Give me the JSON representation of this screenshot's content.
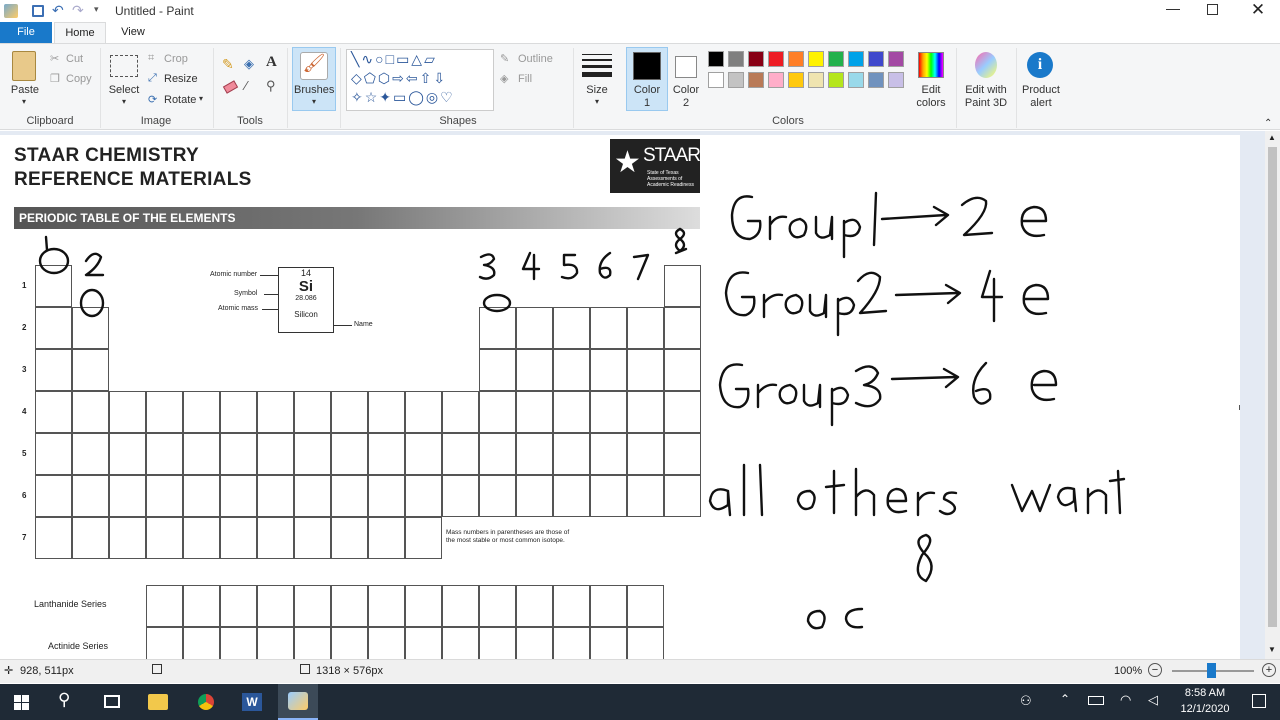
{
  "titlebar": {
    "title": "Untitled - Paint"
  },
  "tabs": [
    {
      "label": "File"
    },
    {
      "label": "Home"
    },
    {
      "label": "View"
    }
  ],
  "ribbon": {
    "clipboard": {
      "paste": "Paste",
      "cut": "Cut",
      "copy": "Copy",
      "group": "Clipboard"
    },
    "image": {
      "select": "Select",
      "crop": "Crop",
      "resize": "Resize",
      "rotate": "Rotate",
      "group": "Image"
    },
    "tools": {
      "group": "Tools"
    },
    "brushes": {
      "label": "Brushes"
    },
    "shapes": {
      "outline": "Outline",
      "fill": "Fill",
      "group": "Shapes"
    },
    "size": {
      "label": "Size"
    },
    "color1": {
      "label": "Color",
      "sub": "1"
    },
    "color2": {
      "label": "Color",
      "sub": "2"
    },
    "colors_group": "Colors",
    "edit_colors": {
      "line1": "Edit",
      "line2": "colors"
    },
    "paint3d": {
      "line1": "Edit with",
      "line2": "Paint 3D"
    },
    "product_alert": {
      "line1": "Product",
      "line2": "alert"
    },
    "palette_row1": [
      "#000000",
      "#7f7f7f",
      "#880015",
      "#ed1c24",
      "#ff7f27",
      "#fff200",
      "#22b14c",
      "#00a2e8",
      "#3f48cc",
      "#a349a4"
    ],
    "palette_row2": [
      "#ffffff",
      "#c3c3c3",
      "#b97a57",
      "#ffaec9",
      "#ffc90e",
      "#efe4b0",
      "#b5e61d",
      "#99d9ea",
      "#7092be",
      "#c8bfe7"
    ]
  },
  "doc": {
    "title1": "STAAR CHEMISTRY",
    "title2": "REFERENCE MATERIALS",
    "logo": "STAAR",
    "logo_sub1": "State of Texas",
    "logo_sub2": "Assessments of",
    "logo_sub3": "Academic Readiness",
    "banner": "PERIODIC TABLE OF THE ELEMENTS",
    "key": {
      "atomic_number": "Atomic number",
      "symbol": "Symbol",
      "atomic_mass": "Atomic mass",
      "name": "Name",
      "num": "14",
      "sym": "Si",
      "mass": "28.086",
      "elname": "Silicon"
    },
    "mass_note1": "Mass numbers in parentheses are those of",
    "mass_note2": "the most stable or most common isotope.",
    "lanthanide": "Lanthanide Series",
    "actinide": "Actinide Series",
    "periods": [
      "1",
      "2",
      "3",
      "4",
      "5",
      "6",
      "7"
    ]
  },
  "notes": {
    "line1": "Group 1 → 2e",
    "line2": "Group 2 → 4e",
    "line3": "Group 3 → 6e",
    "line4": "all others want",
    "line5": "8",
    "line6": "oc"
  },
  "status": {
    "cursor": "928, 511px",
    "size": "1318 × 576px",
    "zoom": "100%"
  },
  "taskbar": {
    "time": "8:58 AM",
    "date": "12/1/2020"
  }
}
